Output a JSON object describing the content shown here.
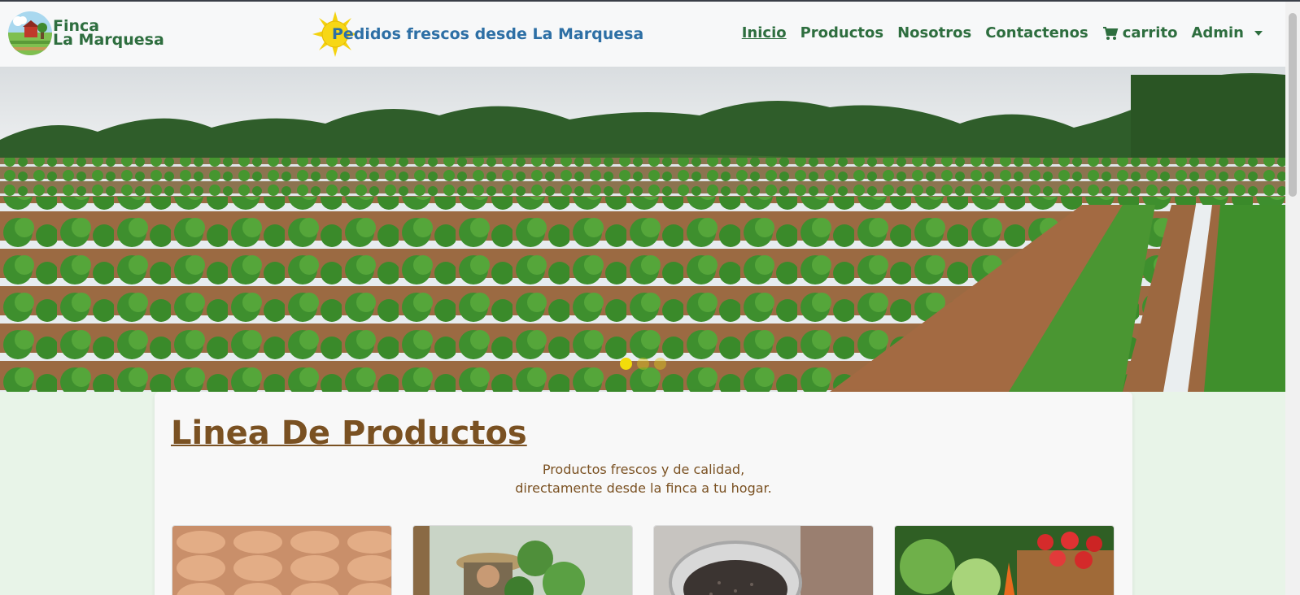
{
  "brand": {
    "line1": "Finca",
    "line2": "La Marquesa"
  },
  "tagline": "Pedidos frescos desde La Marquesa",
  "nav": {
    "inicio": "Inicio",
    "productos": "Productos",
    "nosotros": "Nosotros",
    "contactenos": "Contactenos",
    "carrito": "carrito",
    "admin": "Admin"
  },
  "icons": {
    "cart": "cart-icon",
    "caret": "chevron-down-icon"
  },
  "carousel": {
    "active_index": 0,
    "slide_count": 3
  },
  "section": {
    "title": "Linea De Productos",
    "subtitle_line1": "Productos frescos y de calidad,",
    "subtitle_line2": "directamente desde la finca a tu hogar."
  },
  "colors": {
    "brand_green": "#2e6e3f",
    "tagline_blue": "#2d6fa5",
    "section_brown": "#7a5122",
    "page_bg": "#e8f4e8",
    "indicator_active": "#f2dc0a"
  }
}
